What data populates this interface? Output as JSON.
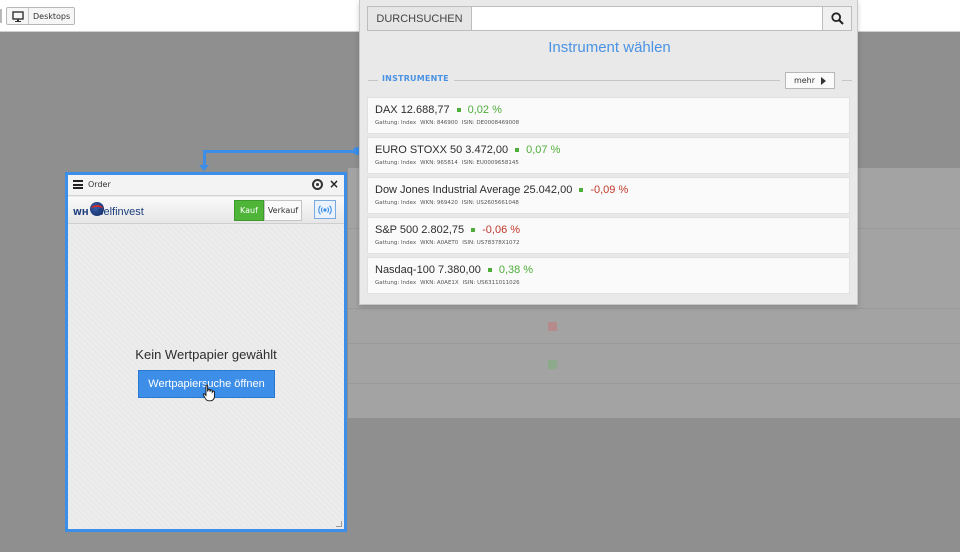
{
  "topbar": {
    "desktops_label": "Desktops"
  },
  "order_panel": {
    "title": "Order",
    "logo_prefix": "WH",
    "logo_text": "selfinvest",
    "buy_label": "Kauf",
    "sell_label": "Verkauf",
    "empty_message": "Kein Wertpapier gewählt",
    "open_search_label": "Wertpapiersuche öffnen"
  },
  "chooser": {
    "search_label": "DURCHSUCHEN",
    "search_value": "",
    "search_placeholder": "",
    "title": "Instrument wählen",
    "section_label": "INSTRUMENTE",
    "more_label": "mehr",
    "instruments": [
      {
        "name": "DAX",
        "price": "12.688,77",
        "change": "0,02 %",
        "direction": "up",
        "gattung": "Gattung: Index",
        "wkn": "WKN: 846900",
        "isin": "ISIN: DE0008469008"
      },
      {
        "name": "EURO STOXX 50",
        "price": "3.472,00",
        "change": "0,07 %",
        "direction": "up",
        "gattung": "Gattung: Index",
        "wkn": "WKN: 965814",
        "isin": "ISIN: EU0009658145"
      },
      {
        "name": "Dow Jones Industrial Average",
        "price": "25.042,00",
        "change": "-0,09 %",
        "direction": "down",
        "gattung": "Gattung: Index",
        "wkn": "WKN: 969420",
        "isin": "ISIN: US2605661048"
      },
      {
        "name": "S&P 500",
        "price": "2.802,75",
        "change": "-0,06 %",
        "direction": "down",
        "gattung": "Gattung: Index",
        "wkn": "WKN: A0AET0",
        "isin": "ISIN: US78378X1072"
      },
      {
        "name": "Nasdaq-100",
        "price": "7.380,00",
        "change": "0,38 %",
        "direction": "up",
        "gattung": "Gattung: Index",
        "wkn": "WKN: A0AE1X",
        "isin": "ISIN: US6311011026"
      }
    ]
  },
  "colors": {
    "accent": "#3d8ee8",
    "positive": "#4fae3a",
    "negative": "#c0392b",
    "buy": "#4fb539"
  }
}
